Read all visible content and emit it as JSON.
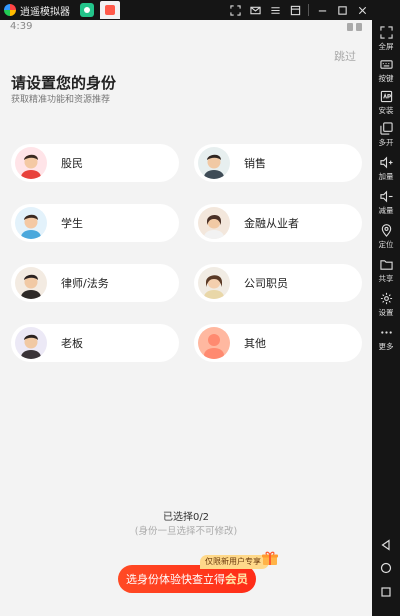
{
  "window": {
    "title": "逍遥模拟器"
  },
  "statusbar": {
    "time": "4:39"
  },
  "page": {
    "skip": "跳过",
    "title": "请设置您的身份",
    "subtitle": "获取精准功能和资源推荐"
  },
  "options": [
    {
      "label": "股民"
    },
    {
      "label": "销售"
    },
    {
      "label": "学生"
    },
    {
      "label": "金融从业者"
    },
    {
      "label": "律师/法务"
    },
    {
      "label": "公司职员"
    },
    {
      "label": "老板"
    },
    {
      "label": "其他"
    }
  ],
  "footer": {
    "selected": "已选择0/2",
    "note": "(身份一旦选择不可修改)",
    "badge": "仅限新用户专享",
    "promo_text": "选身份体验快查立得",
    "promo_strong": "会员"
  },
  "sidebar": {
    "items": [
      {
        "label": "全屏",
        "icon": "fullscreen-icon"
      },
      {
        "label": "按键",
        "icon": "keyboard-icon"
      },
      {
        "label": "安装",
        "icon": "apk-icon"
      },
      {
        "label": "多开",
        "icon": "multi-instance-icon"
      },
      {
        "label": "加量",
        "icon": "volume-up-icon"
      },
      {
        "label": "减量",
        "icon": "volume-down-icon"
      },
      {
        "label": "定位",
        "icon": "location-icon"
      },
      {
        "label": "共享",
        "icon": "folder-icon"
      },
      {
        "label": "设置",
        "icon": "gear-icon"
      },
      {
        "label": "更多",
        "icon": "more-icon"
      }
    ]
  },
  "colors": {
    "accent": "#ff3a1f",
    "background": "#f3f3f3",
    "card": "#ffffff"
  }
}
